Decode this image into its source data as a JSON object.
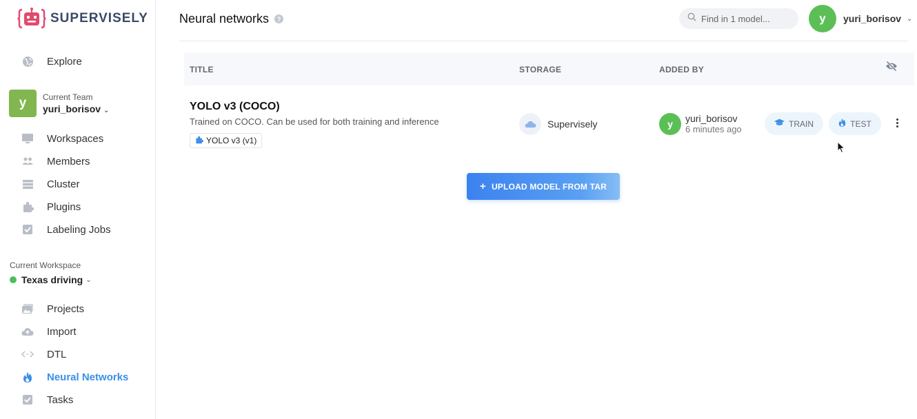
{
  "brand": {
    "name": "SUPERVISELY"
  },
  "sidebar": {
    "explore": "Explore",
    "team": {
      "caption": "Current Team",
      "name": "yuri_borisov",
      "initial": "y"
    },
    "team_items": [
      {
        "label": "Workspaces",
        "icon": "monitor-icon"
      },
      {
        "label": "Members",
        "icon": "members-icon"
      },
      {
        "label": "Cluster",
        "icon": "cluster-icon"
      },
      {
        "label": "Plugins",
        "icon": "puzzle-icon"
      },
      {
        "label": "Labeling Jobs",
        "icon": "checkbox-icon"
      }
    ],
    "workspace": {
      "caption": "Current Workspace",
      "name": "Texas driving",
      "status_color": "#4cbe5a"
    },
    "workspace_items": [
      {
        "label": "Projects",
        "icon": "images-icon"
      },
      {
        "label": "Import",
        "icon": "cloud-upload-icon"
      },
      {
        "label": "DTL",
        "icon": "code-icon"
      },
      {
        "label": "Neural Networks",
        "icon": "flame-icon",
        "active": true
      },
      {
        "label": "Tasks",
        "icon": "checkbox-icon"
      }
    ]
  },
  "header": {
    "title": "Neural networks",
    "search_placeholder": "Find in 1 model...",
    "user": {
      "name": "yuri_borisov",
      "initial": "y"
    }
  },
  "table": {
    "columns": {
      "title": "TITLE",
      "storage": "STORAGE",
      "added_by": "ADDED BY"
    },
    "rows": [
      {
        "title": "YOLO v3 (COCO)",
        "description": "Trained on COCO. Can be used for both training and inference",
        "version": "YOLO v3 (v1)",
        "storage": "Supervisely",
        "added_by": {
          "name": "yuri_borisov",
          "initial": "y",
          "time": "6 minutes ago"
        },
        "actions": {
          "train": "TRAIN",
          "test": "TEST"
        }
      }
    ]
  },
  "upload_button": "UPLOAD MODEL FROM TAR",
  "colors": {
    "accent": "#3b8fe9",
    "avatar_green": "#5cbf55",
    "team_green": "#82b64f"
  }
}
